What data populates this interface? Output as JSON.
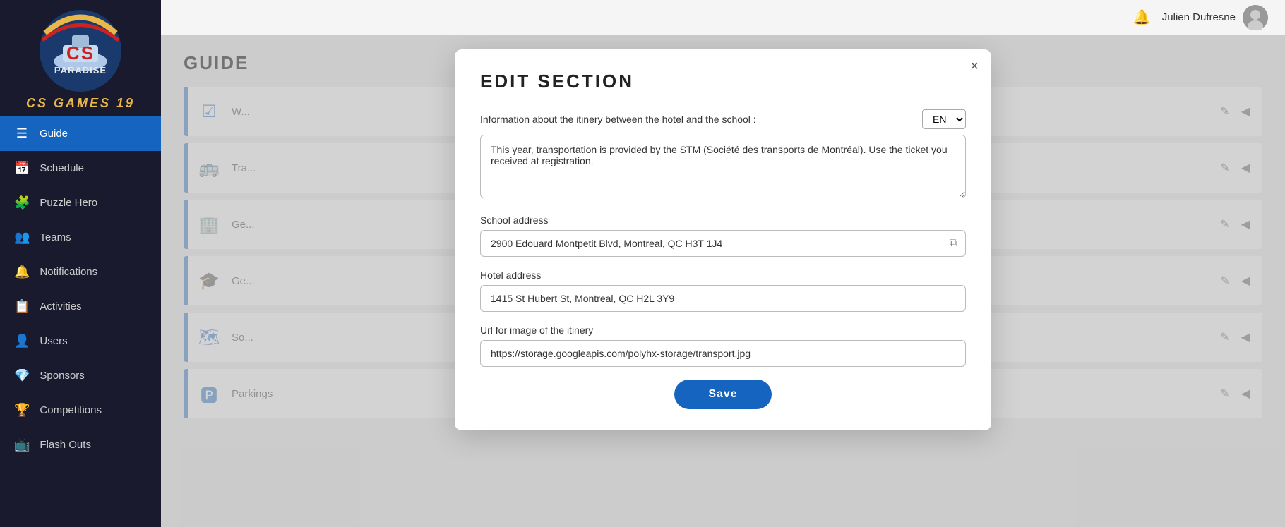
{
  "sidebar": {
    "brand": "CS GAMES 19",
    "nav_items": [
      {
        "id": "guide",
        "label": "Guide",
        "icon": "☰",
        "active": true
      },
      {
        "id": "schedule",
        "label": "Schedule",
        "icon": "📅",
        "active": false
      },
      {
        "id": "puzzle-hero",
        "label": "Puzzle Hero",
        "icon": "🧩",
        "active": false
      },
      {
        "id": "teams",
        "label": "Teams",
        "icon": "👥",
        "active": false
      },
      {
        "id": "notifications",
        "label": "Notifications",
        "icon": "🔔",
        "active": false
      },
      {
        "id": "activities",
        "label": "Activities",
        "icon": "📋",
        "active": false
      },
      {
        "id": "users",
        "label": "Users",
        "icon": "👤",
        "active": false
      },
      {
        "id": "sponsors",
        "label": "Sponsors",
        "icon": "💎",
        "active": false
      },
      {
        "id": "competitions",
        "label": "Competitions",
        "icon": "🏆",
        "active": false
      },
      {
        "id": "flash-outs",
        "label": "Flash Outs",
        "icon": "📺",
        "active": false
      }
    ]
  },
  "topbar": {
    "user_name": "Julien Dufresne",
    "bell_icon": "🔔"
  },
  "page": {
    "title": "GUIDE"
  },
  "guide_rows": [
    {
      "id": "row1",
      "icon": "☑",
      "label": "W..."
    },
    {
      "id": "row2",
      "icon": "🚌",
      "label": "Tra..."
    },
    {
      "id": "row3",
      "icon": "🏢",
      "label": "Ge..."
    },
    {
      "id": "row4",
      "icon": "🎓",
      "label": "Ge..."
    },
    {
      "id": "row5",
      "icon": "🗺",
      "label": "So..."
    },
    {
      "id": "row6",
      "icon": "🅿",
      "label": "Parkings"
    }
  ],
  "modal": {
    "title": "EDIT  SECTION",
    "close_label": "×",
    "description_label": "Information about the itinery between the hotel and the school :",
    "lang_value": "EN",
    "description_value": "This year, transportation is provided by the STM (Société des transports de Montréal). Use the ticket you received at registration.",
    "school_address_label": "School address",
    "school_address_value": "2900 Edouard Montpetit Blvd, Montreal, QC H3T 1J4",
    "hotel_address_label": "Hotel address",
    "hotel_address_value": "1415 St Hubert St, Montreal, QC H2L 3Y9",
    "url_label": "Url for image of the itinery",
    "url_value": "https://storage.googleapis.com/polyhx-storage/transport.jpg",
    "save_label": "Save"
  }
}
